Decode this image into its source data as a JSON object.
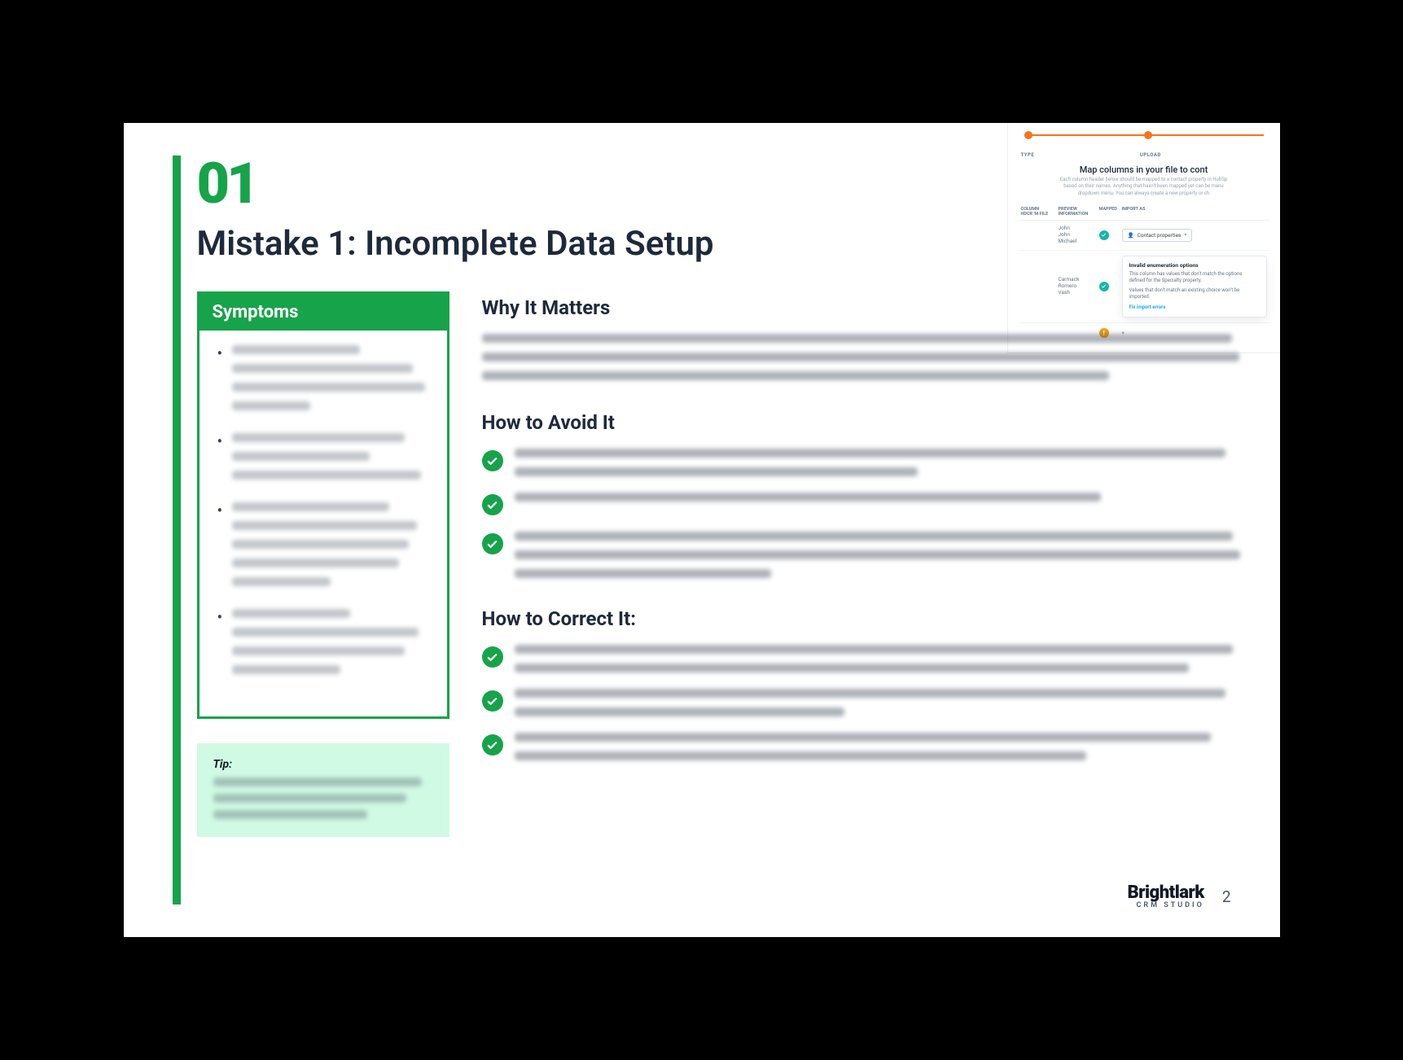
{
  "chapter_number": "01",
  "title": "Mistake 1: Incomplete Data Setup",
  "symptoms": {
    "heading": "Symptoms"
  },
  "tip": {
    "label": "Tip:"
  },
  "sections": {
    "why": "Why It Matters",
    "avoid": "How to Avoid It",
    "correct": "How to Correct It:"
  },
  "footer": {
    "brand_top": "Brightlark",
    "brand_sub": "CRM STUDIO",
    "page_number": "2"
  },
  "inset": {
    "step_a": "TYPE",
    "step_b": "UPLOAD",
    "title": "Map columns in your file to cont",
    "sub1": "Each column header below should be mapped to a contact property in HubSp",
    "sub2": "based on their names. Anything that hasn't been mapped yet can be manu",
    "sub3": "dropdown menu. You can always create a new property or ch",
    "th_a": "COLUMN HDCR 'M FILE",
    "th_b": "PREVIEW INFORMATION",
    "th_c": "MAPPED",
    "th_d": "IMPORT AS",
    "row1_a": "John",
    "row1_b": "John",
    "row1_c": "Michael",
    "row1_pill": "Contact properties",
    "row2_a": "Carmack",
    "row2_b": "Romero",
    "row2_c": "Vash",
    "tt_title": "Invalid enumeration options",
    "tt_body1": "This column has values that don't match the options defined for the Specialty property.",
    "tt_body2": "Values that don't match an existing choice won't be imported.",
    "tt_link": "Fix import errors"
  }
}
